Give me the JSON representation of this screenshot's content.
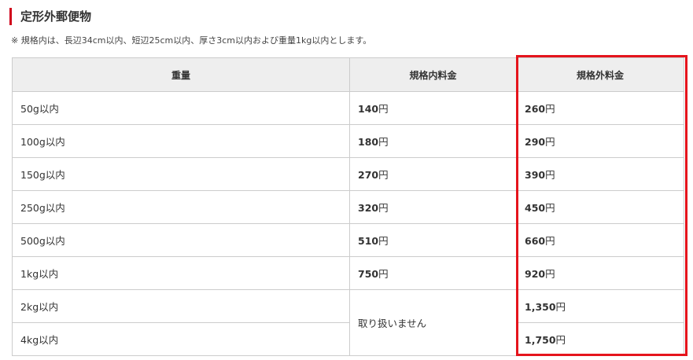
{
  "title": "定形外郵便物",
  "note": "※ 規格内は、長辺34cm以内、短辺25cm以内、厚さ3cm以内および重量1kg以内とします。",
  "columns": {
    "weight": "重量",
    "standard": "規格内料金",
    "nonstandard": "規格外料金"
  },
  "currency_unit": "円",
  "not_handled": "取り扱いません",
  "rows": [
    {
      "weight": "50g以内",
      "standard": "140",
      "nonstandard": "260"
    },
    {
      "weight": "100g以内",
      "standard": "180",
      "nonstandard": "290"
    },
    {
      "weight": "150g以内",
      "standard": "270",
      "nonstandard": "390"
    },
    {
      "weight": "250g以内",
      "standard": "320",
      "nonstandard": "450"
    },
    {
      "weight": "500g以内",
      "standard": "510",
      "nonstandard": "660"
    },
    {
      "weight": "1kg以内",
      "standard": "750",
      "nonstandard": "920"
    },
    {
      "weight": "2kg以内",
      "standard": null,
      "nonstandard": "1,350"
    },
    {
      "weight": "4kg以内",
      "standard": null,
      "nonstandard": "1,750"
    }
  ],
  "colors": {
    "accent": "#d0021b",
    "highlight": "#e5141c",
    "header_bg": "#eeeeee",
    "border": "#cccccc"
  }
}
